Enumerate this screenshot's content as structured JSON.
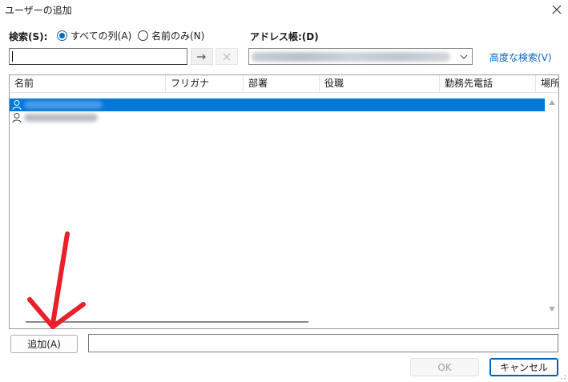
{
  "window": {
    "title": "ユーザーの追加"
  },
  "search": {
    "label": "検索(S):",
    "option_all": "すべての列(A)",
    "option_name": "名前のみ(N)",
    "selected": "all",
    "value": ""
  },
  "addressbook": {
    "label": "アドレス帳:(D)",
    "value_obscured": true
  },
  "advanced_search": "高度な検索(V)",
  "columns": [
    "名前",
    "フリガナ",
    "部署",
    "役職",
    "勤務先電話",
    "場所"
  ],
  "rows": [
    {
      "name_obscured": true,
      "selected": true
    },
    {
      "name_obscured": true,
      "selected": false
    }
  ],
  "buttons": {
    "add": "追加(A)",
    "ok": "OK",
    "cancel": "キャンセル"
  },
  "colors": {
    "accent": "#0067c0",
    "selection": "#0078d7",
    "annotation_arrow": "#e8202a",
    "link": "#0a66c2"
  },
  "icons": [
    "close-icon",
    "arrow-right-icon",
    "clear-icon",
    "chevron-down-icon",
    "person-icon",
    "scroll-up-icon",
    "scroll-down-icon"
  ]
}
